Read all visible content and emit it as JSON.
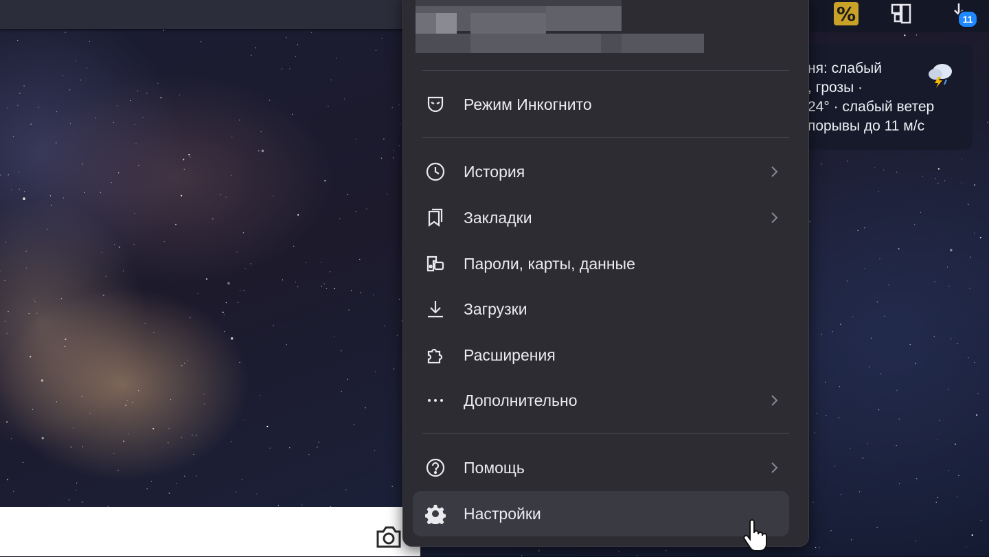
{
  "weather": {
    "text": "ня: слабый\n, грозы ·\n24° · слабый ветер\nпорывы до 11 м/с",
    "icon": "thunderstorm-cloud-icon"
  },
  "topbar": {
    "badge_count": "11",
    "icons": [
      "discount-percent-icon",
      "extension-stack-icon",
      "downloads-icon"
    ]
  },
  "menu": {
    "incognito": {
      "label": "Режим Инкогнито",
      "icon": "incognito-mask-icon"
    },
    "items": [
      {
        "label": "История",
        "icon": "clock-icon",
        "has_submenu": true
      },
      {
        "label": "Закладки",
        "icon": "bookmarks-icon",
        "has_submenu": true
      },
      {
        "label": "Пароли, карты, данные",
        "icon": "passwords-icon",
        "has_submenu": false
      },
      {
        "label": "Загрузки",
        "icon": "download-icon",
        "has_submenu": false
      },
      {
        "label": "Расширения",
        "icon": "puzzle-icon",
        "has_submenu": false
      },
      {
        "label": "Дополнительно",
        "icon": "more-dots-icon",
        "has_submenu": true
      }
    ],
    "help": {
      "label": "Помощь",
      "icon": "help-circle-icon",
      "has_submenu": true
    },
    "settings": {
      "label": "Настройки",
      "icon": "gear-icon",
      "hovered": true
    }
  },
  "colors": {
    "menu_bg": "#2c2c32",
    "menu_hover": "#3a3a42",
    "badge": "#1e88ff",
    "percent_accent": "#f2c230"
  }
}
